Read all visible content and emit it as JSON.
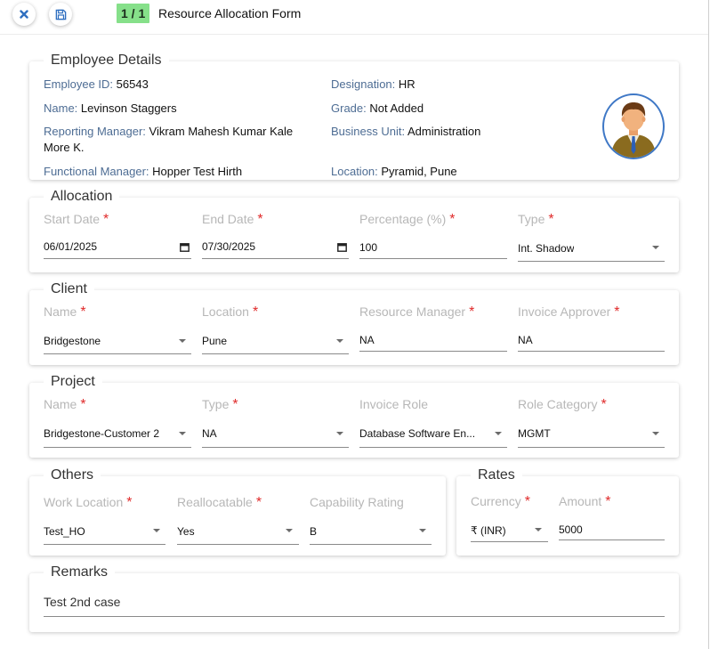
{
  "header": {
    "counter": "1 / 1",
    "title": "Resource Allocation Form"
  },
  "employee": {
    "section_title": "Employee Details",
    "id_label": "Employee ID:",
    "id_value": "56543",
    "designation_label": "Designation:",
    "designation_value": "HR",
    "name_label": "Name:",
    "name_value": "Levinson Staggers",
    "grade_label": "Grade:",
    "grade_value": "Not Added",
    "reporting_label": "Reporting Manager:",
    "reporting_value_line1": "Vikram Mahesh Kumar Kale",
    "reporting_value_line2": "More K.",
    "business_label": "Business Unit:",
    "business_value": "Administration",
    "functional_label": "Functional Manager:",
    "functional_value": "Hopper Test Hirth",
    "location_label": "Location:",
    "location_value": "Pyramid, Pune"
  },
  "allocation": {
    "section_title": "Allocation",
    "start_label": "Start Date",
    "start_value": "06/01/2025",
    "end_label": "End Date",
    "end_value": "07/30/2025",
    "percentage_label": "Percentage (%)",
    "percentage_value": "100",
    "type_label": "Type",
    "type_value": "Int. Shadow"
  },
  "client": {
    "section_title": "Client",
    "name_label": "Name",
    "name_value": "Bridgestone",
    "location_label": "Location",
    "location_value": "Pune",
    "rm_label": "Resource Manager",
    "rm_value": "NA",
    "approver_label": "Invoice Approver",
    "approver_value": "NA"
  },
  "project": {
    "section_title": "Project",
    "name_label": "Name",
    "name_value": "Bridgestone-Customer 2",
    "type_label": "Type",
    "type_value": "NA",
    "role_label": "Invoice Role",
    "role_value": "Database Software En...",
    "category_label": "Role Category",
    "category_value": "MGMT"
  },
  "others": {
    "section_title": "Others",
    "work_label": "Work Location",
    "work_value": "Test_HO",
    "realloc_label": "Reallocatable",
    "realloc_value": "Yes",
    "capability_label": "Capability Rating",
    "capability_value": "B"
  },
  "rates": {
    "section_title": "Rates",
    "currency_label": "Currency",
    "currency_value": "₹ (INR)",
    "amount_label": "Amount",
    "amount_value": "5000"
  },
  "remarks": {
    "section_title": "Remarks",
    "value": "Test 2nd case"
  },
  "required_mark": "*",
  "colors": {
    "accent": "#2f6fc0",
    "counter_bg": "#86e08a",
    "required": "#e02a2a",
    "detail_label": "#4e6d94"
  }
}
